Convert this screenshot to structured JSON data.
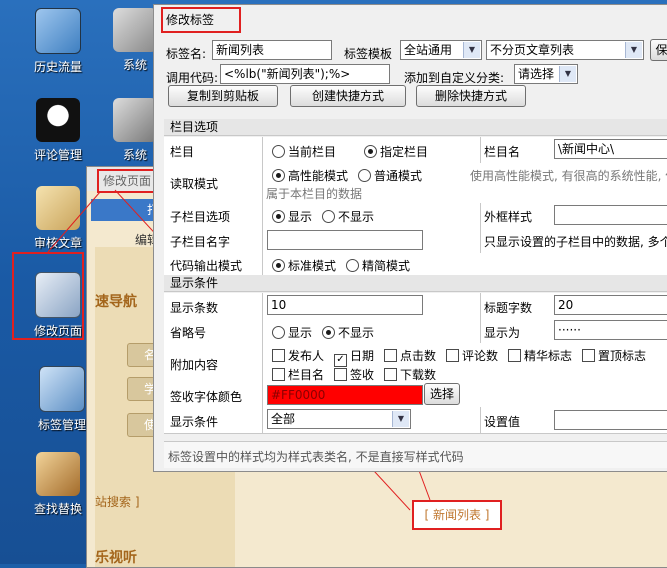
{
  "desktop_icons": [
    {
      "label": "历史流量"
    },
    {
      "label": "系统"
    },
    {
      "label": "评论管理"
    },
    {
      "label": "系统"
    },
    {
      "label": "审核文章"
    },
    {
      "label": "修改页面"
    },
    {
      "label": "标签管理"
    },
    {
      "label": "查找替换"
    }
  ],
  "bg_window": {
    "title": "修改页面",
    "open_label": "打开",
    "edit_label": "编辑",
    "nav_heading": "速导航",
    "pills": [
      "名片",
      "学生",
      "使用"
    ],
    "search_label": "站搜索 ]",
    "footer_label": "乐视听"
  },
  "dialog": {
    "title": "修改标签",
    "tag_name_label": "标签名:",
    "tag_name_value": "新闻列表",
    "template_label": "标签模板",
    "template_value": "全站通用",
    "template2_value": "不分页文章列表",
    "save_btn": "保",
    "call_code_label": "调用代码:",
    "call_code_value": "<%lb(\"新闻列表\");%>",
    "custom_cat_label": "添加到自定义分类:",
    "custom_cat_value": "请选择",
    "copy_btn": "复制到剪贴板",
    "create_shortcut_btn": "创建快捷方式",
    "delete_shortcut_btn": "删除快捷方式",
    "section_column": "栏目选项",
    "column_label": "栏目",
    "radio_current": "当前栏目",
    "radio_specified": "指定栏目",
    "column_name_label": "栏目名",
    "column_name_value": "\\新闻中心\\",
    "read_mode_label": "读取模式",
    "radio_high": "高性能模式",
    "radio_normal": "普通模式",
    "read_mode_note": "使用高性能模式, 有很高的系统性能, 但",
    "read_mode_note2": "属于本栏目的数据",
    "sub_col_label": "子栏目选项",
    "radio_show": "显示",
    "radio_hide": "不显示",
    "outer_style_label": "外框样式",
    "sub_col_name_label": "子栏目名字",
    "sub_col_note": "只显示设置的子栏目中的数据, 多个",
    "output_mode_label": "代码输出模式",
    "radio_standard": "标准模式",
    "radio_simple": "精简模式",
    "section_display": "显示条件",
    "count_label": "显示条数",
    "count_value": "10",
    "title_chars_label": "标题字数",
    "title_chars_value": "20",
    "ellipsis_label": "省略号",
    "radio_show2": "显示",
    "radio_hide2": "不显示",
    "show_as_label": "显示为",
    "show_as_value": "······",
    "attach_label": "附加内容",
    "checks_row1": [
      {
        "label": "发布人",
        "checked": false
      },
      {
        "label": "日期",
        "checked": true
      },
      {
        "label": "点击数",
        "checked": false
      },
      {
        "label": "评论数",
        "checked": false
      },
      {
        "label": "精华标志",
        "checked": false
      },
      {
        "label": "置顶标志",
        "checked": false
      }
    ],
    "checks_row2": [
      {
        "label": "栏目名",
        "checked": false
      },
      {
        "label": "签收",
        "checked": false
      },
      {
        "label": "下载数",
        "checked": false
      }
    ],
    "sign_color_label": "签收字体颜色",
    "sign_color_value": "#FF0000",
    "choose_btn": "选择",
    "display_cond_label": "显示条件",
    "display_cond_value": "全部",
    "set_value_label": "设置值",
    "footer_note": "标签设置中的样式均为样式表类名, 不是直接写样式代码"
  },
  "callout_tag": "[ 新闻列表 ]",
  "colors": {
    "highlight": "#E02020",
    "sign_color": "#FF0000",
    "desktop": "#1D5FA8"
  }
}
